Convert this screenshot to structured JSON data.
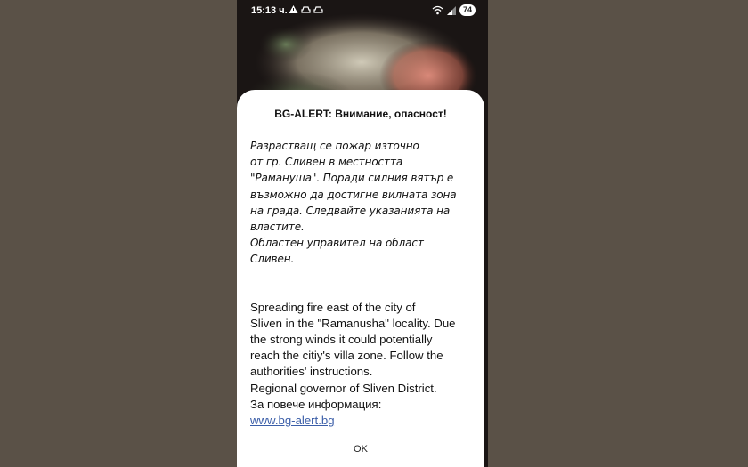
{
  "status_bar": {
    "time": "15:13 ч.",
    "battery": "74"
  },
  "alert": {
    "title": "BG-ALERT: Внимание, опасност!",
    "bulgarian_lines": [
      "Разрастващ се пожар източно",
      "от гр. Сливен в местността",
      "\"Рамануша\". Поради силния вятър е",
      "възможно да достигне вилната зона",
      "на града. Следвайте указанията на",
      "властите.",
      "Областен управител на област",
      "Сливен."
    ],
    "english_lines": [
      "Spreading fire east of the city of",
      "Sliven in the \"Ramanusha\" locality. Due",
      "the strong winds it could potentially",
      "reach the citiy's villa zone. Follow the",
      "authorities' instructions.",
      "Regional governor of Sliven District.",
      "За повече информация:"
    ],
    "link": "www.bg-alert.bg",
    "ok_label": "OK"
  },
  "icons": [
    "warning-icon",
    "car-icon",
    "car-icon",
    "wifi-icon",
    "signal-icon"
  ],
  "colors": {
    "link": "#3b5ea8",
    "background": "#5a5147",
    "dialog": "#ffffff"
  }
}
